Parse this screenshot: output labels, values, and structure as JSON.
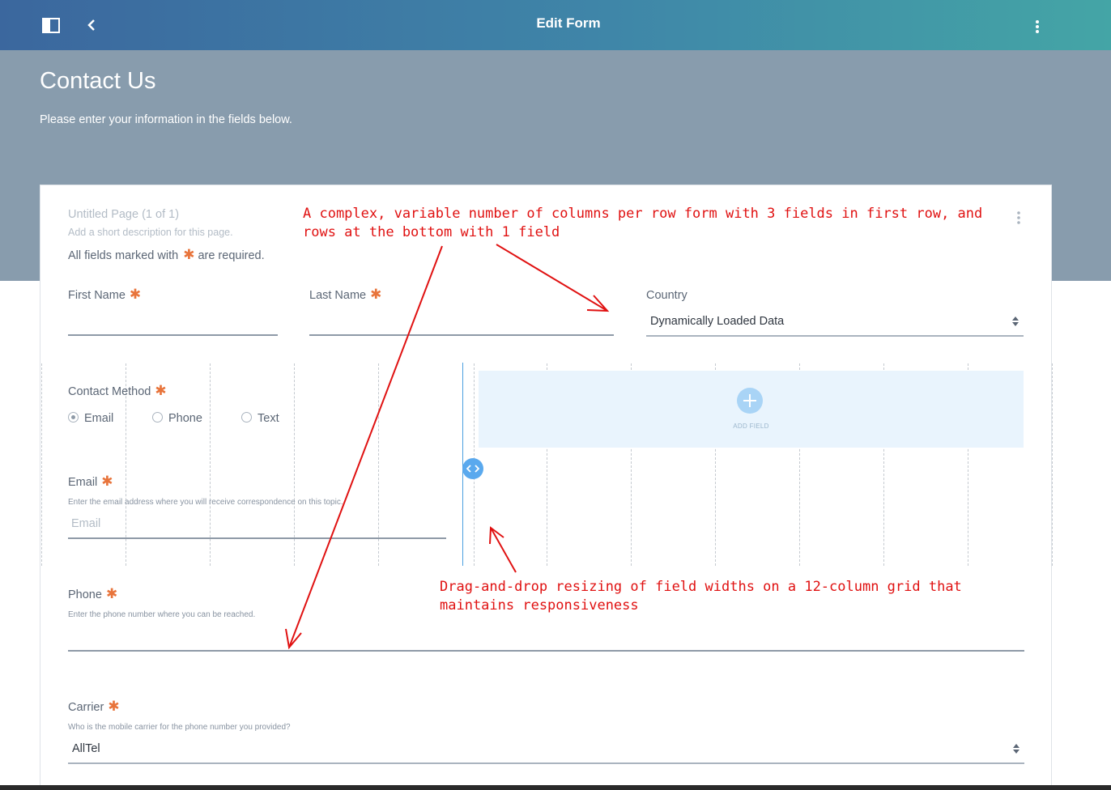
{
  "topbar": {
    "title": "Edit Form",
    "icons": [
      "sidebar-toggle-icon",
      "chevron-left-icon",
      "more-vertical-icon"
    ]
  },
  "hero": {
    "title": "Contact Us",
    "description": "Please enter your information in the fields below."
  },
  "page": {
    "title": "Untitled Page (1 of 1)",
    "description": "Add a short description for this page.",
    "required_prefix": "All fields marked with",
    "required_suffix": "are required.",
    "required_symbol": "✱"
  },
  "fields": {
    "first_name": {
      "label": "First Name",
      "required": true
    },
    "last_name": {
      "label": "Last Name",
      "required": true
    },
    "country": {
      "label": "Country",
      "value": "Dynamically Loaded Data"
    },
    "contact_method": {
      "label": "Contact Method",
      "required": true,
      "options": [
        "Email",
        "Phone",
        "Text"
      ],
      "selected": "Email"
    },
    "email": {
      "label": "Email",
      "required": true,
      "help": "Enter the email address where you will receive correspondence on this topic.",
      "placeholder": "Email"
    },
    "phone": {
      "label": "Phone",
      "required": true,
      "help": "Enter the phone number where you can be reached."
    },
    "carrier": {
      "label": "Carrier",
      "required": true,
      "help": "Who is the mobile carrier for the phone number you provided?",
      "value": "AllTel"
    }
  },
  "add_field": {
    "label": "ADD FIELD"
  },
  "annotations": {
    "top_line1": "A complex, variable number of columns per row form with 3 fields in first row, and",
    "top_line2": "rows at the bottom with 1 field",
    "bottom_line1": "Drag-and-drop resizing of field widths on a 12-column grid that",
    "bottom_line2": "maintains responsiveness"
  },
  "colors": {
    "topbar_start": "#3b679e",
    "topbar_end": "#44a5a6",
    "hero_bg": "#889cad",
    "required_star": "#e8743b",
    "add_zone_bg": "#e9f4fd",
    "resize_handle": "#5aa9ee",
    "annotation_red": "#e01111"
  }
}
